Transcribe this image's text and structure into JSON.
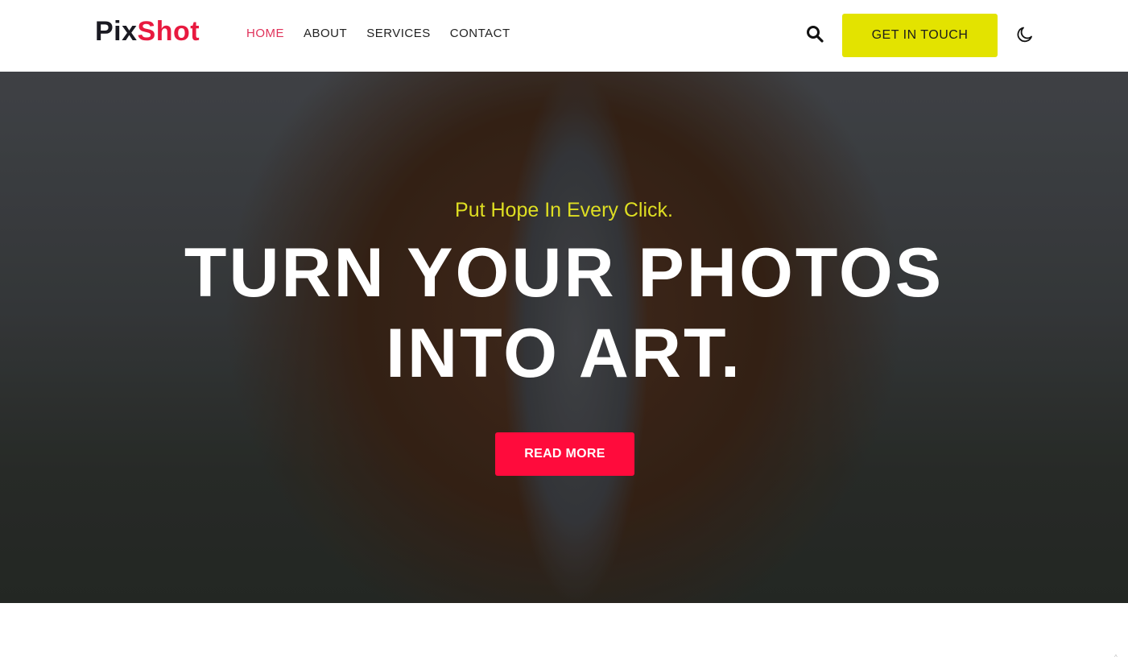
{
  "header": {
    "logo": {
      "part1": "Pix",
      "part2": "Shot"
    },
    "nav": [
      {
        "label": "HOME",
        "active": true
      },
      {
        "label": "ABOUT"
      },
      {
        "label": "SERVICES"
      },
      {
        "label": "CONTACT"
      }
    ],
    "search_icon": "search-icon",
    "cta_label": "GET IN TOUCH",
    "theme_icon": "moon-icon"
  },
  "hero": {
    "tagline": "Put Hope In Every Click.",
    "title_line1": "TURN YOUR PHOTOS",
    "title_line2": "INTO ART.",
    "button_label": "READ MORE"
  },
  "scroll_top": "^",
  "colors": {
    "brand": "#e8193f",
    "cta": "#e3e300",
    "read_more": "#ff0b3c",
    "tagline": "#dede22"
  }
}
